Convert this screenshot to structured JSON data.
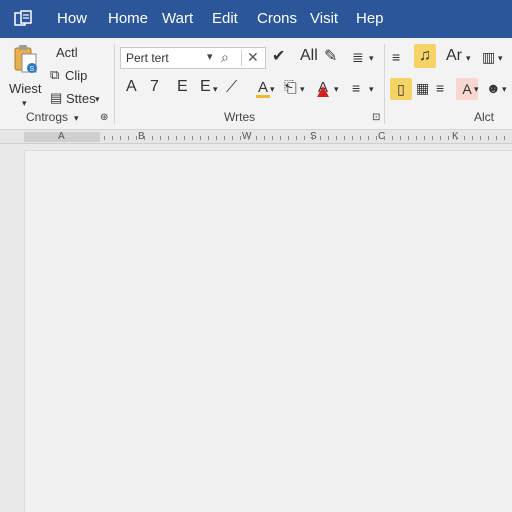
{
  "menubar": {
    "app_icon": "document-icon",
    "items": [
      {
        "label": "How"
      },
      {
        "label": "Home"
      },
      {
        "label": "Wart"
      },
      {
        "label": "Edit"
      },
      {
        "label": "Crons"
      },
      {
        "label": "Visit"
      },
      {
        "label": "Hep"
      }
    ]
  },
  "ribbon": {
    "clipboard": {
      "paste_label": "Wiest",
      "act_label": "Actl",
      "clip_label": "Clip",
      "styles_label": "Sttes",
      "group_label": "Cntrogs"
    },
    "font": {
      "font_name": "Pert tert",
      "font_size": "All",
      "row2": [
        "A",
        "7",
        "E",
        "E"
      ],
      "group_label": "Wrtes"
    },
    "styles": {
      "style_glyph": "Ar",
      "group_label": "Alct"
    },
    "colors": {
      "highlight": "#f6d365",
      "pink": "#f8d7d0",
      "red": "#d42020",
      "accent": "#2b579a"
    }
  },
  "ruler": {
    "labels": [
      "A",
      "B",
      "W",
      "S",
      "C",
      "K"
    ]
  }
}
